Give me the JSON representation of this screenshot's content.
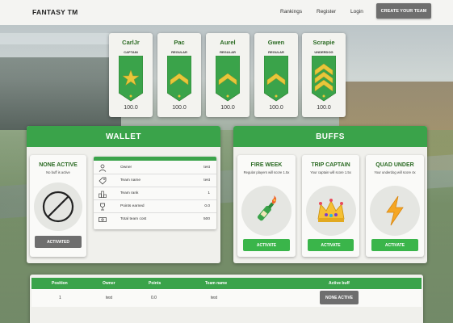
{
  "header": {
    "brand": "FANTASY TM",
    "nav": [
      "Rankings",
      "Register",
      "Login"
    ],
    "cta": "CREATE YOUR TEAM"
  },
  "players": [
    {
      "name": "CarlJr",
      "role": "CAPTAIN",
      "score": "100.0",
      "badge": "star"
    },
    {
      "name": "Pac",
      "role": "REGULAR",
      "score": "100.0",
      "badge": "chevron-1"
    },
    {
      "name": "Aurel",
      "role": "REGULAR",
      "score": "100.0",
      "badge": "chevron-1"
    },
    {
      "name": "Gwen",
      "role": "REGULAR",
      "score": "100.0",
      "badge": "chevron-1"
    },
    {
      "name": "Scrapie",
      "role": "UNDERDOG",
      "score": "100.0",
      "badge": "chevron-3"
    }
  ],
  "wallet": {
    "title": "WALLET",
    "active_buff": {
      "title": "NONE ACTIVE",
      "desc": "No buff is active",
      "button": "ACTIVATED"
    },
    "rows": [
      {
        "label": "Owner",
        "value": "test",
        "icon": "user-icon"
      },
      {
        "label": "Team name",
        "value": "test",
        "icon": "tag-icon"
      },
      {
        "label": "Team rank",
        "value": "1",
        "icon": "podium-icon"
      },
      {
        "label": "Points earned",
        "value": "0.0",
        "icon": "trophy-icon"
      },
      {
        "label": "Total team cost",
        "value": "500",
        "icon": "money-icon"
      }
    ]
  },
  "buffs": {
    "title": "BUFFS",
    "items": [
      {
        "title": "FIRE WEEK",
        "desc": "Regular players will score 1.5x",
        "button": "ACTIVATE",
        "icon": "champagne-icon"
      },
      {
        "title": "TRIP CAPTAIN",
        "desc": "Your captain will score 1.5x",
        "button": "ACTIVATE",
        "icon": "crown-icon"
      },
      {
        "title": "QUAD UNDER",
        "desc": "Your underdog will score 4x",
        "button": "ACTIVATE",
        "icon": "lightning-icon"
      }
    ]
  },
  "standings": {
    "columns": [
      "Position",
      "Owner",
      "Points",
      "Team name",
      "Active buff"
    ],
    "rows": [
      {
        "position": "1",
        "owner": "test",
        "points": "0.0",
        "team": "test",
        "buff": "NONE ACTIVE"
      }
    ]
  },
  "colors": {
    "accent": "#3aa34a",
    "accent_text": "#2a6a22",
    "grey_button": "#6e6e6e"
  }
}
